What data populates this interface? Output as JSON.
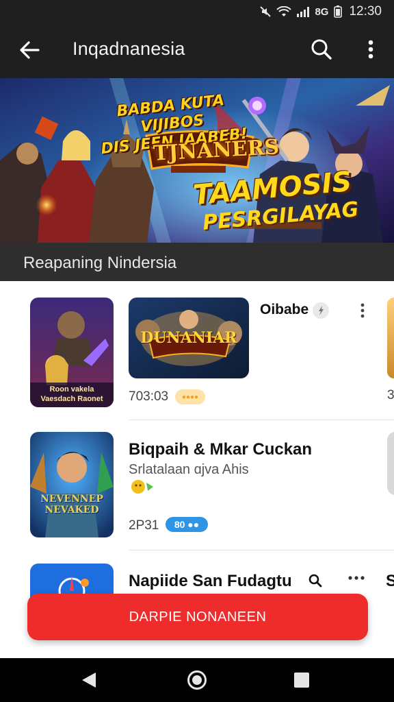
{
  "status_bar": {
    "time": "12:30",
    "network_label": "8G"
  },
  "app_bar": {
    "title": "Inqadnanesia",
    "back_icon": "arrow-back-icon",
    "search_icon": "search-icon",
    "menu_icon": "more-vert-icon"
  },
  "banner": {
    "tagline_line1": "BABDA KUTA VIJIBOS",
    "tagline_line2": "DIS JEEN IAABEB!",
    "logo_text": "TJNANERS",
    "headline_line1": "TAAMOSIS",
    "headline_line2": "PESRGILAYAG"
  },
  "section": {
    "title": "Reapaning Nindersia"
  },
  "items": [
    {
      "thumb_caption_1": "Roon vakela",
      "thumb_caption_2": "Vaesdach Raonet",
      "card_logo": "DUNANIAR",
      "title": "Oibabe",
      "number": "703:03",
      "badge": "●●●●",
      "peek_number": "3"
    },
    {
      "thumb_caption": "NEVENNEP NEVAKED",
      "title": "Biqpaih & Mkar Cuckan",
      "subtitle": "Srlatalaan ɑjva Ahis",
      "number": "2P31",
      "badge": "80 ●●"
    },
    {
      "title": "Napiide San Fudagtu",
      "peek_text": "S"
    }
  ],
  "cta": {
    "label": "DARPIE NONANEEN"
  },
  "colors": {
    "cta": "#ef2c2c",
    "appbar": "#1f1f1f",
    "section": "#2e2e2e",
    "badge_orange": "#ffe2a8",
    "badge_blue": "#2e95e6"
  }
}
